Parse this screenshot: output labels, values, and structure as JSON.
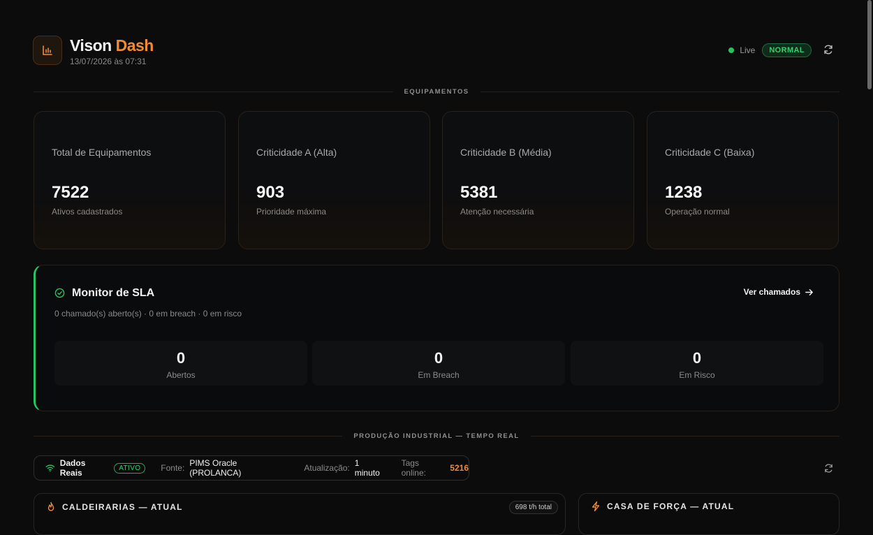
{
  "header": {
    "title_main": "Vison",
    "title_accent": "Dash",
    "timestamp": "13/07/2026 às 07:31",
    "live_label": "Live",
    "status": "NORMAL"
  },
  "sections": {
    "equipment": "EQUIPAMENTOS",
    "production": "PRODUÇÃO INDUSTRIAL — TEMPO REAL"
  },
  "cards": [
    {
      "label": "Total de Equipamentos",
      "value": "7522",
      "sub": "Ativos cadastrados"
    },
    {
      "label": "Criticidade A (Alta)",
      "value": "903",
      "sub": "Prioridade máxima"
    },
    {
      "label": "Criticidade B (Média)",
      "value": "5381",
      "sub": "Atenção necessária"
    },
    {
      "label": "Criticidade C (Baixa)",
      "value": "1238",
      "sub": "Operação normal"
    }
  ],
  "sla": {
    "title": "Monitor de SLA",
    "summary": "0 chamado(s) aberto(s) · 0 em breach · 0 em risco",
    "link": "Ver chamados",
    "stats": [
      {
        "value": "0",
        "label": "Abertos"
      },
      {
        "value": "0",
        "label": "Em Breach"
      },
      {
        "value": "0",
        "label": "Em Risco"
      }
    ]
  },
  "source": {
    "label": "Dados Reais",
    "badge": "ATIVO",
    "fonte_label": "Fonte:",
    "fonte_value": "PIMS Oracle (PROLANCA)",
    "update_label": "Atualização:",
    "update_value": "1 minuto",
    "tags_label": "Tags online:",
    "tags_value": "5216"
  },
  "panels": [
    {
      "title": "CALDEIRARIAS — ATUAL",
      "pill": "698 t/h total",
      "icon": "flame-icon"
    },
    {
      "title": "CASA DE FORÇA — ATUAL",
      "icon": "bolt-icon"
    }
  ],
  "colors": {
    "accent": "#f08a35",
    "success": "#22c55e"
  }
}
